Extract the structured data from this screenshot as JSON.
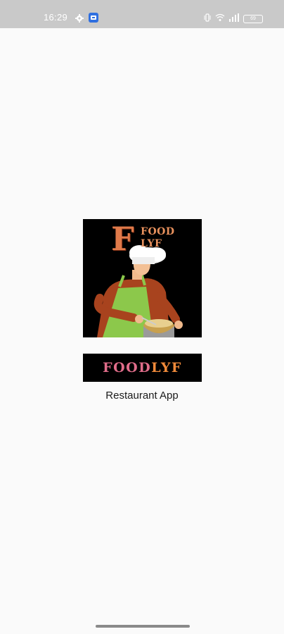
{
  "status_bar": {
    "time": "16:29",
    "battery": "69",
    "left_icons": [
      "gear-icon",
      "app-notification-icon"
    ],
    "right_icons": [
      "vibrate-icon",
      "wifi-icon",
      "signal-icon",
      "battery-icon"
    ]
  },
  "splash": {
    "logo_letter": "F",
    "logo_line1": "FOOD",
    "logo_line2": "LYF",
    "wordmark_part1": "FOOD",
    "wordmark_part2": "LYF",
    "subtitle": "Restaurant App"
  },
  "colors": {
    "background": "#fafafa",
    "status_bar": "#c9c9c9",
    "logo_bg": "#000000",
    "wordmark_food": "#e06d8a",
    "wordmark_lyf": "#f08a3a"
  }
}
